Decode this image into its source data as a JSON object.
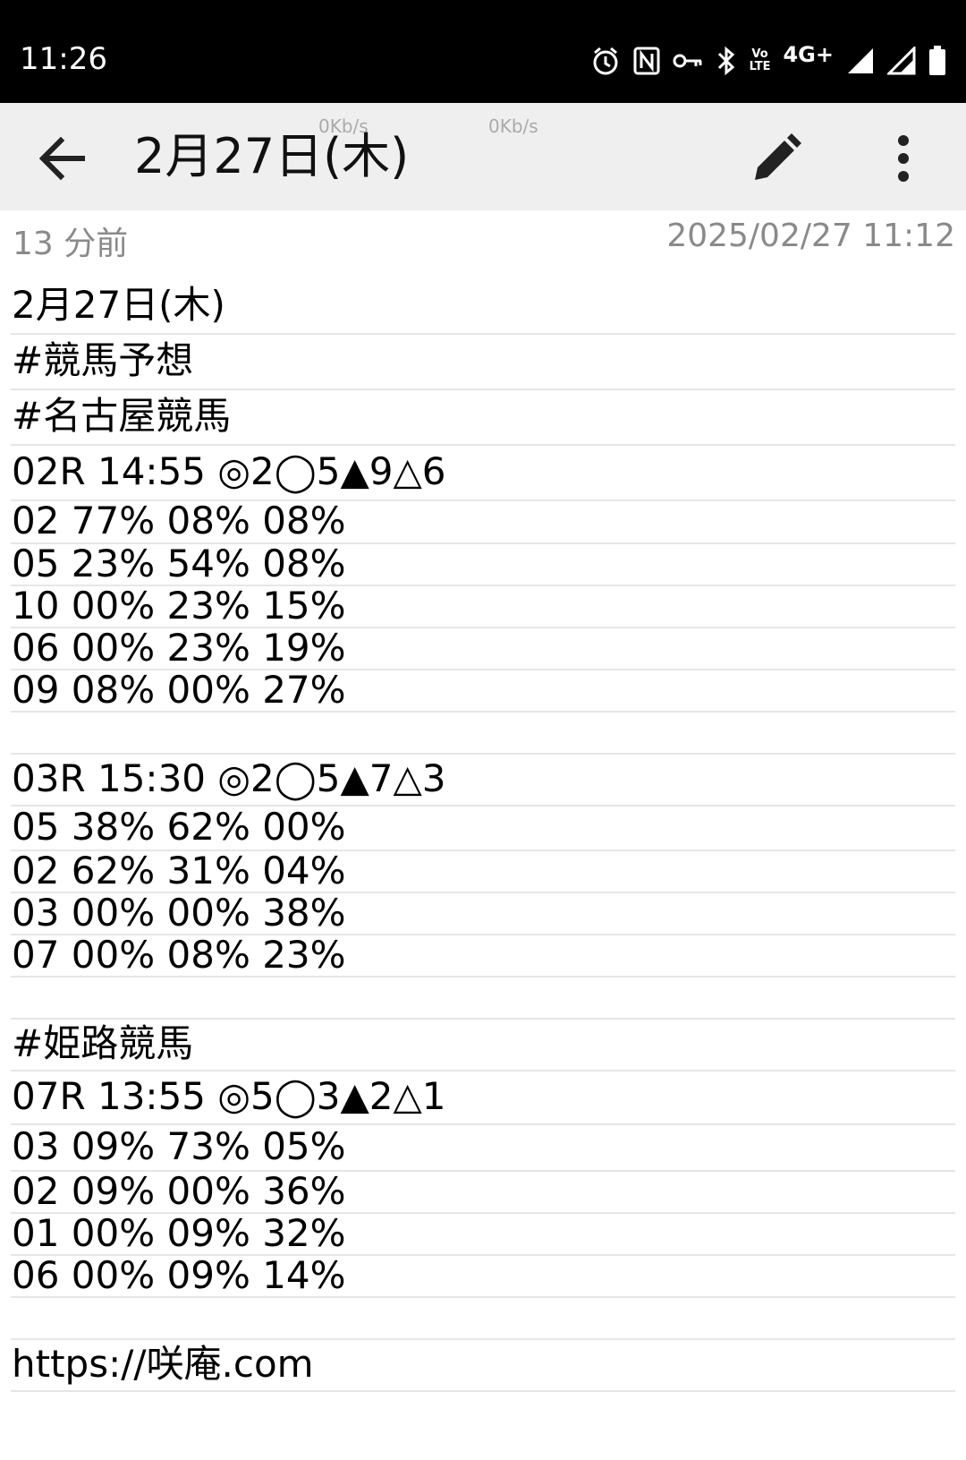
{
  "status_bar": {
    "time": "11:26",
    "icons": [
      "alarm-icon",
      "nfc-icon",
      "vpn-key-icon",
      "bluetooth-icon",
      "volte-icon",
      "network-4g-icon",
      "signal-icon",
      "signal-icon",
      "battery-icon"
    ],
    "volte_line1": "Vo",
    "volte_line2": "LTE",
    "network": "4G+"
  },
  "speed_overlay": {
    "left": "0Kb/s",
    "right": "0Kb/s"
  },
  "app_bar": {
    "title": "2月27日(木)"
  },
  "meta": {
    "relative_time": "13 分前",
    "timestamp": "2025/02/27 11:12"
  },
  "note_lines": [
    "2月27日(木)",
    "#競馬予想",
    "#名古屋競馬",
    "02R 14:55 ◎2◯5▲9△6",
    "02 77% 08% 08%",
    "05 23% 54% 08%",
    "10 00% 23% 15%",
    "06 00% 23% 19%",
    "09 08% 00% 27%",
    "",
    "03R 15:30 ◎2◯5▲7△3",
    "05 38% 62% 00%",
    "02 62% 31% 04%",
    "03 00% 00% 38%",
    "07 00% 08% 23%",
    "",
    "#姫路競馬",
    "07R 13:55 ◎5◯3▲2△1",
    "03 09% 73% 05%",
    "02 09% 00% 36%",
    "01 00% 09% 32%",
    "06 00% 09% 14%",
    "",
    "https://咲庵.com"
  ],
  "colors": {
    "status_bar_bg": "#000000",
    "app_bar_bg": "#efefef",
    "meta_text": "#8a8a8a",
    "rule_line": "#e6e6e6"
  }
}
